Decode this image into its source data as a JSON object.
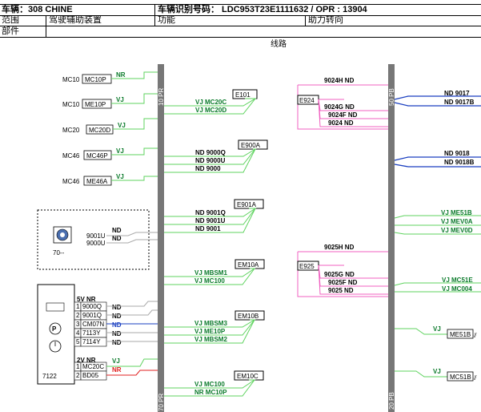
{
  "header": {
    "vehicle_label": "车辆：308 CHINE",
    "vin_label": "车辆识别号码： LDC953T23E1111632 / OPR : 13904",
    "scope_label": "范围",
    "scope_value": "驾驶辅助装置",
    "function_label": "功能",
    "function_value": "助力转向",
    "part_label": "部件"
  },
  "section_title": "线路",
  "left_connectors": [
    {
      "pin": "MC10",
      "box": "MC10P",
      "wire": "NR"
    },
    {
      "pin": "MC10",
      "box": "ME10P",
      "wire": "VJ"
    },
    {
      "pin": "MC20",
      "box": "MC20D",
      "wire": "VJ"
    },
    {
      "pin": "MC46",
      "box": "MC46P",
      "wire": "VJ"
    },
    {
      "pin": "MC46",
      "box": "ME46A",
      "wire": "VJ"
    }
  ],
  "sensor_box": {
    "label": "70--",
    "pins": [
      "9001U",
      "9000U"
    ],
    "wires": [
      "ND",
      "ND"
    ]
  },
  "module": {
    "id": "7122",
    "group1_label": "5V NR",
    "group1_pins": [
      {
        "n": "1",
        "code": "9000Q",
        "wire": "ND"
      },
      {
        "n": "2",
        "code": "9001Q",
        "wire": "ND"
      },
      {
        "n": "3",
        "code": "CM07N",
        "wire": "ND"
      },
      {
        "n": "4",
        "code": "7113Y",
        "wire": "ND"
      },
      {
        "n": "5",
        "code": "7114Y",
        "wire": "ND"
      }
    ],
    "group2_label": "2V NR",
    "group2_pins": [
      {
        "n": "1",
        "code": "MC20C",
        "wire": "VJ"
      },
      {
        "n": "2",
        "code": "BD05",
        "wire": "NR"
      }
    ]
  },
  "bus_labels": {
    "left_top": "10 PR",
    "left_bottom": "70 PR",
    "right_top": "50 PB",
    "right_bottom": "20 PB"
  },
  "middle_blocks": [
    {
      "id": "E101",
      "lines": [
        "VJ MC20C",
        "VJ MC20D"
      ]
    },
    {
      "id": "E900A",
      "lines": [
        "ND 9000Q",
        "ND 9000U",
        "ND 9000"
      ]
    },
    {
      "id": "E901A",
      "lines": [
        "ND 9001Q",
        "ND 9001U",
        "ND 9001"
      ]
    },
    {
      "id": "EM10A",
      "lines": [
        "VJ MBSM1",
        "VJ MC100"
      ]
    },
    {
      "id": "EM10B",
      "lines": [
        "VJ MBSM3",
        "VJ ME10P",
        "VJ MBSM2"
      ]
    },
    {
      "id": "EM10C",
      "lines": [
        "VJ MC100",
        "NR MC10P"
      ]
    }
  ],
  "right_splices": [
    {
      "id": "E924",
      "top": "9024H ND",
      "lines": [
        "9024G ND",
        "9024F ND",
        "9024 ND"
      ]
    },
    {
      "id": "E925",
      "top": "9025H ND",
      "lines": [
        "9025G ND",
        "9025F ND",
        "9025 ND"
      ]
    }
  ],
  "right_outputs": {
    "nd_9017": [
      "ND 9017",
      "ND 9017B"
    ],
    "nd_9018": [
      "ND 9018",
      "ND 9018B"
    ],
    "vj_me51": [
      "VJ ME51B",
      "VJ MEV0A",
      "VJ MEV0D"
    ],
    "vj_mc51": [
      "VJ MC51E",
      "VJ MC004"
    ],
    "out1": {
      "wire": "VJ",
      "box": "ME51B"
    },
    "out2": {
      "wire": "VJ",
      "box": "MC51B"
    }
  },
  "colors": {
    "green": "#5fd35f",
    "pink": "#f060c0",
    "blue": "#1a3fc0",
    "red": "#e02020",
    "dark_green": "#0a7a2a",
    "bus": "#777777"
  }
}
